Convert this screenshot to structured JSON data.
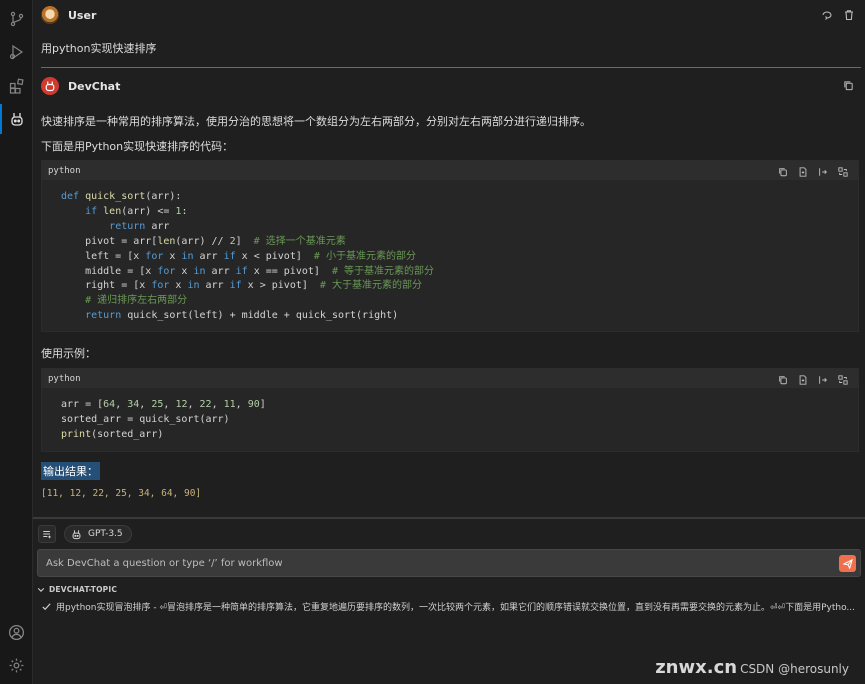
{
  "user_message": {
    "name": "User",
    "text": "用python实现快速排序"
  },
  "bot_message": {
    "name": "DevChat",
    "intro": "快速排序是一种常用的排序算法，使用分治的思想将一个数组分为左右两部分，分别对左右两部分进行递归排序。",
    "code_intro": "下面是用Python实现快速排序的代码：",
    "code_block_1": {
      "language": "python",
      "lines": [
        "def quick_sort(arr):",
        "    if len(arr) <= 1:",
        "        return arr",
        "    pivot = arr[len(arr) // 2]  # 选择一个基准元素",
        "    left = [x for x in arr if x < pivot]  # 小于基准元素的部分",
        "    middle = [x for x in arr if x == pivot]  # 等于基准元素的部分",
        "    right = [x for x in arr if x > pivot]  # 大于基准元素的部分",
        "    # 递归排序左右两部分",
        "    return quick_sort(left) + middle + quick_sort(right)"
      ]
    },
    "usage_label": "使用示例：",
    "code_block_2": {
      "language": "python",
      "lines": [
        "arr = [64, 34, 25, 12, 22, 11, 90]",
        "sorted_arr = quick_sort(arr)",
        "print(sorted_arr)"
      ]
    },
    "output_label": "输出结果：",
    "output_value": "[11, 12, 22, 25, 34, 64, 90]"
  },
  "toolbar": {
    "model": "GPT-3.5"
  },
  "input": {
    "placeholder": "Ask DevChat a question or type ‘/’ for workflow"
  },
  "topics": {
    "title": "DEVCHAT-TOPIC",
    "items": [
      {
        "text": "用python实现冒泡排序 - ⏎冒泡排序是一种简单的排序算法，它重复地遍历要排序的数列，一次比较两个元素，如果它们的顺序错误就交换位置，直到没有再需要交换的元素为止。⏎⏎下面是用Pytho..."
      }
    ]
  },
  "watermark": {
    "big": "znwx.cn",
    "small": "CSDN @herosunly"
  },
  "colors": {
    "accent": "#0078d4",
    "send": "#f0704d",
    "selection": "#264f78",
    "bot_avatar": "#d13a2e"
  },
  "icons": {
    "activity_bar": [
      "source-control-icon",
      "run-debug-icon",
      "extensions-icon",
      "devchat-icon",
      "account-icon",
      "settings-gear-icon"
    ],
    "user_actions": [
      "edit-icon",
      "delete-icon"
    ],
    "bot_actions": [
      "copy-icon"
    ],
    "code_actions": [
      "copy-icon",
      "new-file-icon",
      "insert-icon",
      "diff-icon"
    ]
  }
}
